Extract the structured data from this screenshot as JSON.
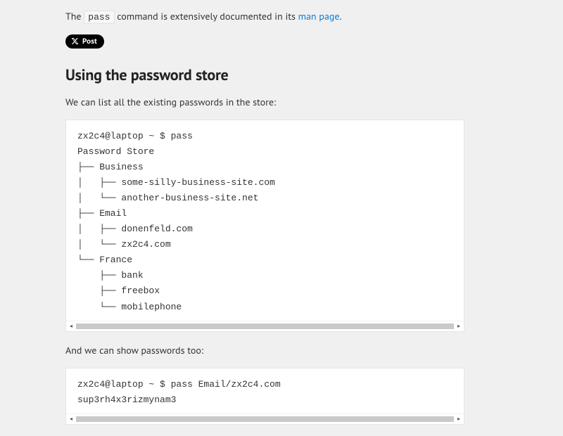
{
  "intro": {
    "prefix": "The ",
    "command": "pass",
    "mid": " command is extensively documented in its ",
    "link_text": "man page",
    "suffix": "."
  },
  "share": {
    "label": "Post"
  },
  "section_heading": "Using the password store",
  "para_list": "We can list all the existing passwords in the store:",
  "codeblock1": "zx2c4@laptop ~ $ pass\nPassword Store\n├── Business\n│   ├── some-silly-business-site.com\n│   └── another-business-site.net\n├── Email\n│   ├── donenfeld.com\n│   └── zx2c4.com\n└── France\n    ├── bank\n    ├── freebox\n    └── mobilephone",
  "para_show": "And we can show passwords too:",
  "codeblock2": "zx2c4@laptop ~ $ pass Email/zx2c4.com\nsup3rh4x3rizmynam3"
}
